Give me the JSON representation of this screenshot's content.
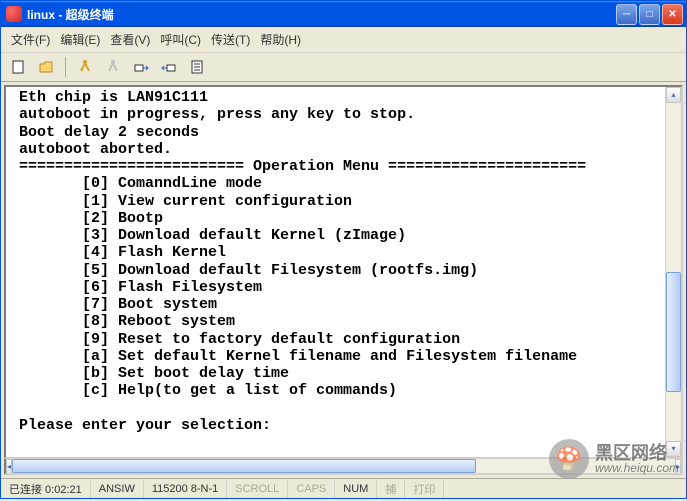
{
  "window": {
    "title": "linux - 超级终端"
  },
  "menu": {
    "file": "文件(F)",
    "edit": "编辑(E)",
    "view": "查看(V)",
    "call": "呼叫(C)",
    "transfer": "传送(T)",
    "help": "帮助(H)"
  },
  "terminal": {
    "lines": [
      " Eth chip is LAN91C111",
      " autoboot in progress, press any key to stop.",
      " Boot delay 2 seconds",
      " autoboot aborted.",
      " ========================= Operation Menu ======================",
      "        [0] ComanndLine mode",
      "        [1] View current configuration",
      "        [2] Bootp",
      "        [3] Download default Kernel (zImage)",
      "        [4] Flash Kernel",
      "        [5] Download default Filesystem (rootfs.img)",
      "        [6] Flash Filesystem",
      "        [7] Boot system",
      "        [8] Reboot system",
      "        [9] Reset to factory default configuration",
      "        [a] Set default Kernel filename and Filesystem filename",
      "        [b] Set boot delay time",
      "        [c] Help(to get a list of commands)",
      "",
      " Please enter your selection:"
    ]
  },
  "status": {
    "connected": "已连接 0:02:21",
    "term": "ANSIW",
    "baud": "115200 8-N-1",
    "scroll": "SCROLL",
    "caps": "CAPS",
    "num": "NUM",
    "capture": "捕",
    "print": "打印"
  },
  "watermark": {
    "name": "黑区网络",
    "url": "www.heiqu.com"
  }
}
